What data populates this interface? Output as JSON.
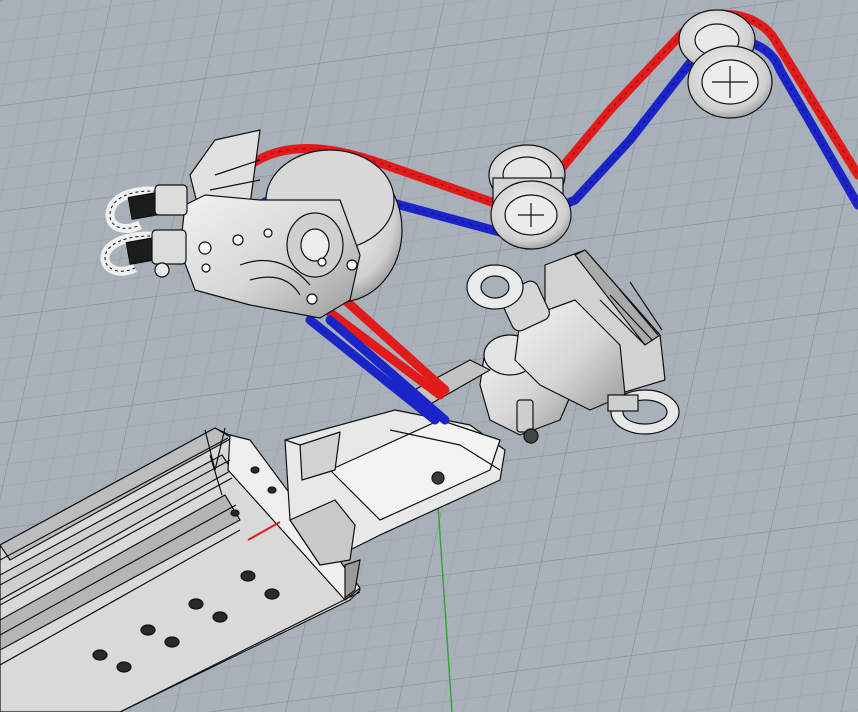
{
  "viewport": {
    "view_name": "",
    "background_color": "#a8b0ba",
    "grid_color": "#8f98a3",
    "grid_visible": true,
    "display_mode": "shaded-with-edges"
  },
  "scene": {
    "rope_colors": {
      "red": "#e31a1a",
      "blue": "#1a24c8"
    },
    "axis_colors": {
      "green": "#2ea52e"
    },
    "part_fill": "#e6e6e6",
    "edge_color": "#101010",
    "objects": [
      {
        "name": "upper-double-pulley",
        "icon": "pulley"
      },
      {
        "name": "middle-double-pulley",
        "icon": "pulley"
      },
      {
        "name": "swivel-block-pulley",
        "icon": "block"
      },
      {
        "name": "snap-shackle-pair",
        "icon": "shackle"
      },
      {
        "name": "eye-bolt",
        "icon": "ring"
      },
      {
        "name": "ring-eye",
        "icon": "ring"
      },
      {
        "name": "clamp-bracket",
        "icon": "bracket"
      },
      {
        "name": "jaw-joint",
        "icon": "joint"
      },
      {
        "name": "extrusion-boom",
        "icon": "profile"
      },
      {
        "name": "red-rope",
        "icon": "rope"
      },
      {
        "name": "blue-rope",
        "icon": "rope"
      },
      {
        "name": "world-y-axis",
        "icon": "axis"
      }
    ]
  }
}
